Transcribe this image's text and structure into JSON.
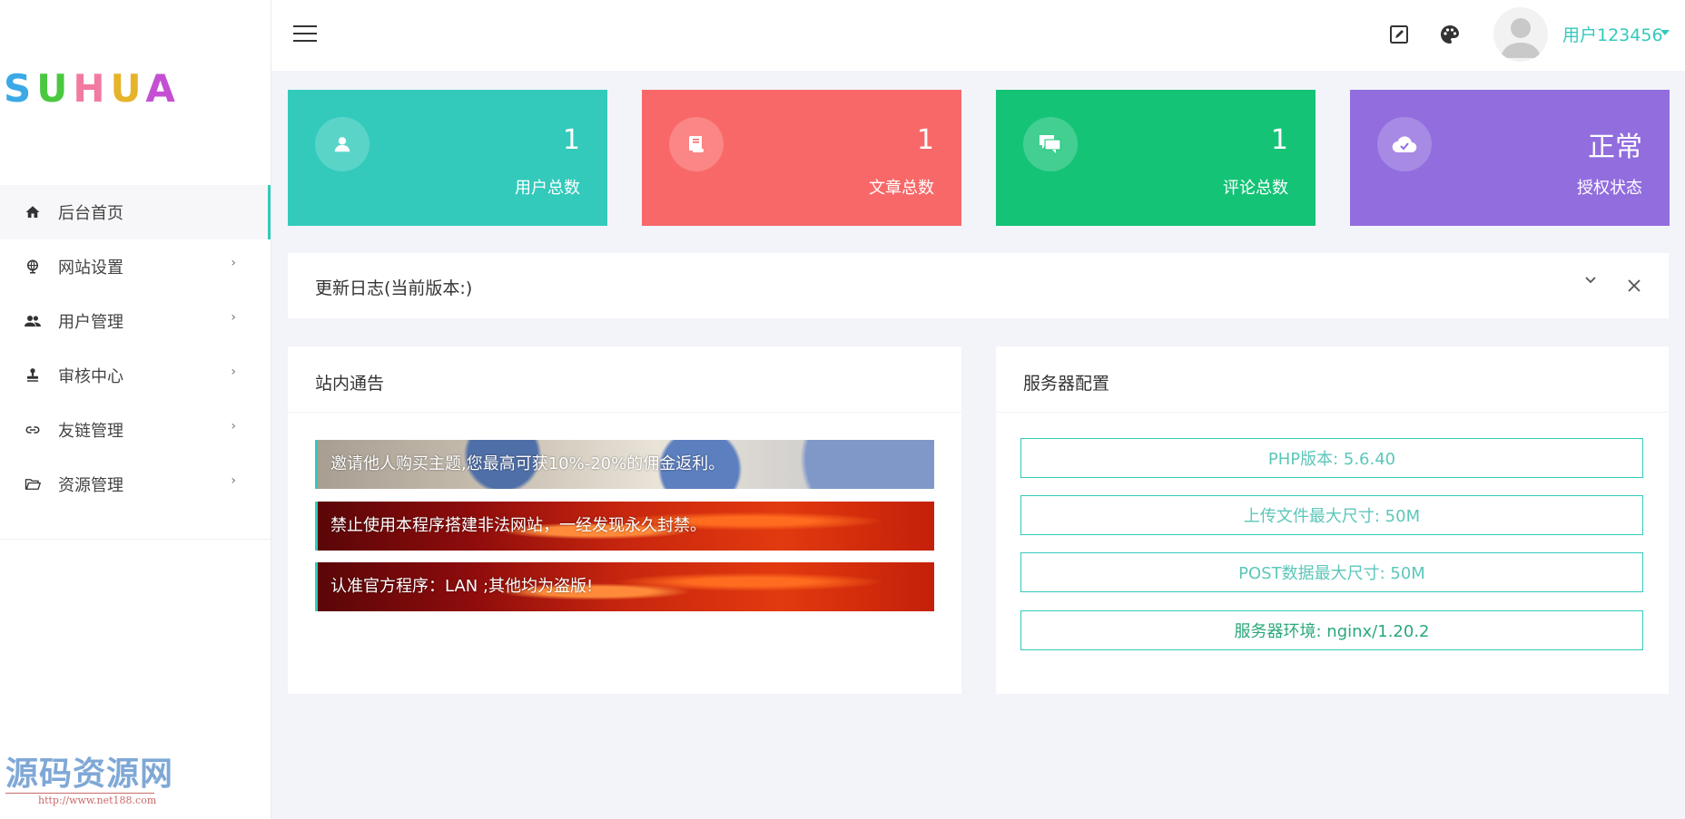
{
  "brand": {
    "logo_letters": [
      "S",
      "U",
      "H",
      "U",
      "A"
    ],
    "logo_colors": [
      "#3aa9e6",
      "#49c840",
      "#f27aa0",
      "#e6b42a",
      "#c44fd2"
    ]
  },
  "accent_color": "#33cabb",
  "sidebar": {
    "items": [
      {
        "label": "后台首页",
        "icon": "home-icon",
        "active": true,
        "has_arrow": false
      },
      {
        "label": "网站设置",
        "icon": "globe-icon",
        "active": false,
        "has_arrow": true
      },
      {
        "label": "用户管理",
        "icon": "users-icon",
        "active": false,
        "has_arrow": true
      },
      {
        "label": "审核中心",
        "icon": "stamp-icon",
        "active": false,
        "has_arrow": true
      },
      {
        "label": "友链管理",
        "icon": "link-icon",
        "active": false,
        "has_arrow": true
      },
      {
        "label": "资源管理",
        "icon": "folder-icon",
        "active": false,
        "has_arrow": true
      }
    ],
    "arrow_glyph": "›"
  },
  "watermark": {
    "title": "源码资源网",
    "url": "http://www.net188.com"
  },
  "topbar": {
    "menu_icon": "hamburger-icon",
    "edit_icon": "edit-icon",
    "theme_icon": "palette-icon",
    "user_name": "用户123456"
  },
  "stats": [
    {
      "value": "1",
      "label": "用户总数",
      "icon": "user-icon",
      "color": "#33cabb"
    },
    {
      "value": "1",
      "label": "文章总数",
      "icon": "article-icon",
      "color": "#f96868"
    },
    {
      "value": "1",
      "label": "评论总数",
      "icon": "comments-icon",
      "color": "#15c377"
    },
    {
      "value": "正常",
      "label": "授权状态",
      "icon": "cloud-check-icon",
      "color": "#926dde"
    }
  ],
  "changelog": {
    "title": "更新日志(当前版本:)"
  },
  "notices": {
    "title": "站内通告",
    "items": [
      "邀请他人购买主题,您最高可获10%-20%的佣金返利。",
      "禁止使用本程序搭建非法网站，一经发现永久封禁。",
      "认准官方程序：LAN ;其他均为盗版!"
    ]
  },
  "server": {
    "title": "服务器配置",
    "rows": [
      "PHP版本: 5.6.40",
      "上传文件最大尺寸: 50M",
      "POST数据最大尺寸: 50M",
      "服务器环境: nginx/1.20.2"
    ]
  }
}
